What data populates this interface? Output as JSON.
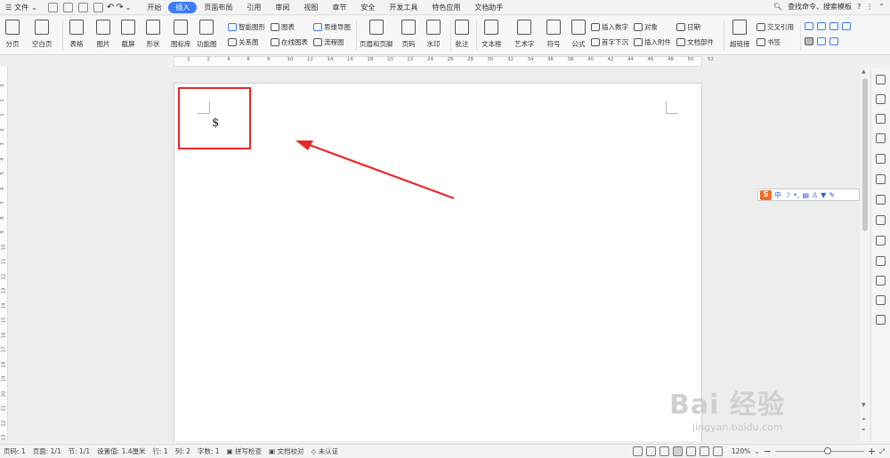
{
  "menubar": {
    "file_label": "文件",
    "tabs": [
      {
        "label": "开始",
        "active": false
      },
      {
        "label": "插入",
        "active": true
      },
      {
        "label": "页面布局",
        "active": false
      },
      {
        "label": "引用",
        "active": false
      },
      {
        "label": "审阅",
        "active": false
      },
      {
        "label": "视图",
        "active": false
      },
      {
        "label": "章节",
        "active": false
      },
      {
        "label": "安全",
        "active": false
      },
      {
        "label": "开发工具",
        "active": false
      },
      {
        "label": "特色应用",
        "active": false
      },
      {
        "label": "文档助手",
        "active": false
      }
    ],
    "search_label": "查找命令、搜索模板",
    "help_icon": "question-icon"
  },
  "ribbon": {
    "page_break": "分页",
    "blank_page": "空白页",
    "table": "表格",
    "picture": "图片",
    "screenshot": "截屏",
    "shape": "形状",
    "icon_lib": "图标库",
    "function_chart": "功能图",
    "smart_shape": "智能图形",
    "relation_chart": "关系图",
    "chart": "图表",
    "online_chart": "在线图表",
    "mind_map": "思维导图",
    "flowchart": "流程图",
    "header_footer": "页眉和页脚",
    "page_number": "页码",
    "watermark_btn": "水印",
    "comment": "批注",
    "text_box": "文本框",
    "word_art": "艺术字",
    "symbol": "符号",
    "formula": "公式",
    "insert_number": "插入数字",
    "drop_cap": "首字下沉",
    "object": "对象",
    "insert_attachment": "插入附件",
    "date": "日期",
    "doc_parts": "文档部件",
    "hyperlink": "超链接",
    "cross_ref": "交叉引用",
    "bookmark": "书签"
  },
  "ruler_ticks": [
    "2",
    "2",
    "4",
    "6",
    "8",
    "10",
    "12",
    "14",
    "16",
    "18",
    "20",
    "22",
    "24",
    "26",
    "28",
    "30",
    "32",
    "34",
    "36",
    "38",
    "40",
    "42",
    "44",
    "46",
    "48",
    "50",
    "52"
  ],
  "vruler_ticks": [
    "2",
    "1",
    "1",
    "2",
    "3",
    "4",
    "5",
    "6",
    "7",
    "8",
    "9",
    "10",
    "11",
    "12",
    "13",
    "14",
    "15",
    "16",
    "17",
    "18",
    "19",
    "20",
    "21",
    "22",
    "23"
  ],
  "document": {
    "content_char": "$"
  },
  "ime": {
    "logo": "S",
    "mode": "中"
  },
  "statusbar": {
    "page_no": "页码: 1",
    "pages": "页面: 1/1",
    "section": "节: 1/1",
    "position": "设置值: 1.4厘米",
    "row": "行: 1",
    "col": "列: 2",
    "word_count": "字数: 1",
    "spell_check": "拼写检查",
    "doc_proof": "文档校对",
    "uncertified": "未认证",
    "zoom": "120%",
    "zoom_fraction": 0.6
  },
  "watermark": {
    "main": "Bai 经验",
    "sub": "jingyan.baidu.com"
  },
  "colors": {
    "accent": "#3c7cf6",
    "annotation": "#e82828",
    "ime_logo": "#f36b20"
  }
}
